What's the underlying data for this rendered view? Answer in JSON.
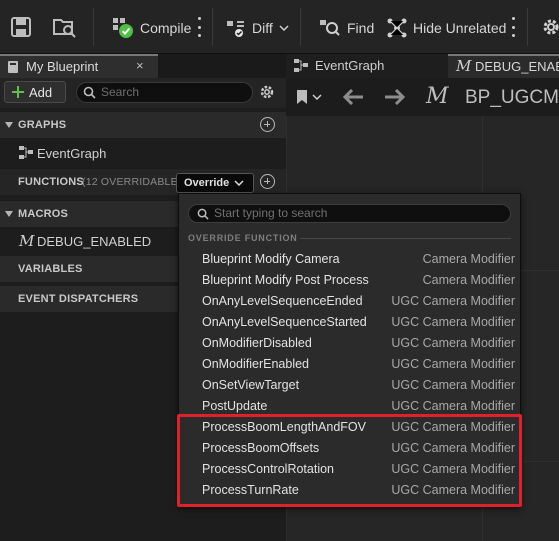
{
  "toolbar": {
    "compile_label": "Compile",
    "diff_label": "Diff",
    "find_label": "Find",
    "hide_unrelated_label": "Hide Unrelated"
  },
  "left_tab": {
    "title": "My Blueprint",
    "close": "×"
  },
  "add_button": {
    "label": "Add"
  },
  "search": {
    "placeholder": "Search"
  },
  "sections": {
    "graphs": "GRAPHS",
    "functions": "FUNCTIONS",
    "functions_count": "(12 OVERRIDABLE)",
    "macros": "MACROS",
    "variables": "VARIABLES",
    "event_dispatchers": "EVENT DISPATCHERS"
  },
  "items": {
    "event_graph": "EventGraph",
    "debug_enabled": "DEBUG_ENABLED"
  },
  "override_button": {
    "label": "Override"
  },
  "right_tabs": [
    {
      "label": "EventGraph"
    },
    {
      "label": "DEBUG_ENABL"
    }
  ],
  "breadcrumb": {
    "label": "BP_UGCMo"
  },
  "dropdown": {
    "search_placeholder": "Start typing to search",
    "category": "OVERRIDE FUNCTION",
    "rows": [
      {
        "name": "Blueprint Modify Camera",
        "category": "Camera Modifier"
      },
      {
        "name": "Blueprint Modify Post Process",
        "category": "Camera Modifier"
      },
      {
        "name": "OnAnyLevelSequenceEnded",
        "category": "UGC Camera Modifier"
      },
      {
        "name": "OnAnyLevelSequenceStarted",
        "category": "UGC Camera Modifier"
      },
      {
        "name": "OnModifierDisabled",
        "category": "UGC Camera Modifier"
      },
      {
        "name": "OnModifierEnabled",
        "category": "UGC Camera Modifier"
      },
      {
        "name": "OnSetViewTarget",
        "category": "UGC Camera Modifier"
      },
      {
        "name": "PostUpdate",
        "category": "UGC Camera Modifier"
      },
      {
        "name": "ProcessBoomLengthAndFOV",
        "category": "UGC Camera Modifier"
      },
      {
        "name": "ProcessBoomOffsets",
        "category": "UGC Camera Modifier"
      },
      {
        "name": "ProcessControlRotation",
        "category": "UGC Camera Modifier"
      },
      {
        "name": "ProcessTurnRate",
        "category": "UGC Camera Modifier"
      }
    ]
  },
  "colors": {
    "highlight": "#e0202a",
    "add_plus": "#5ec24a",
    "compile_check": "#4fbf45"
  }
}
